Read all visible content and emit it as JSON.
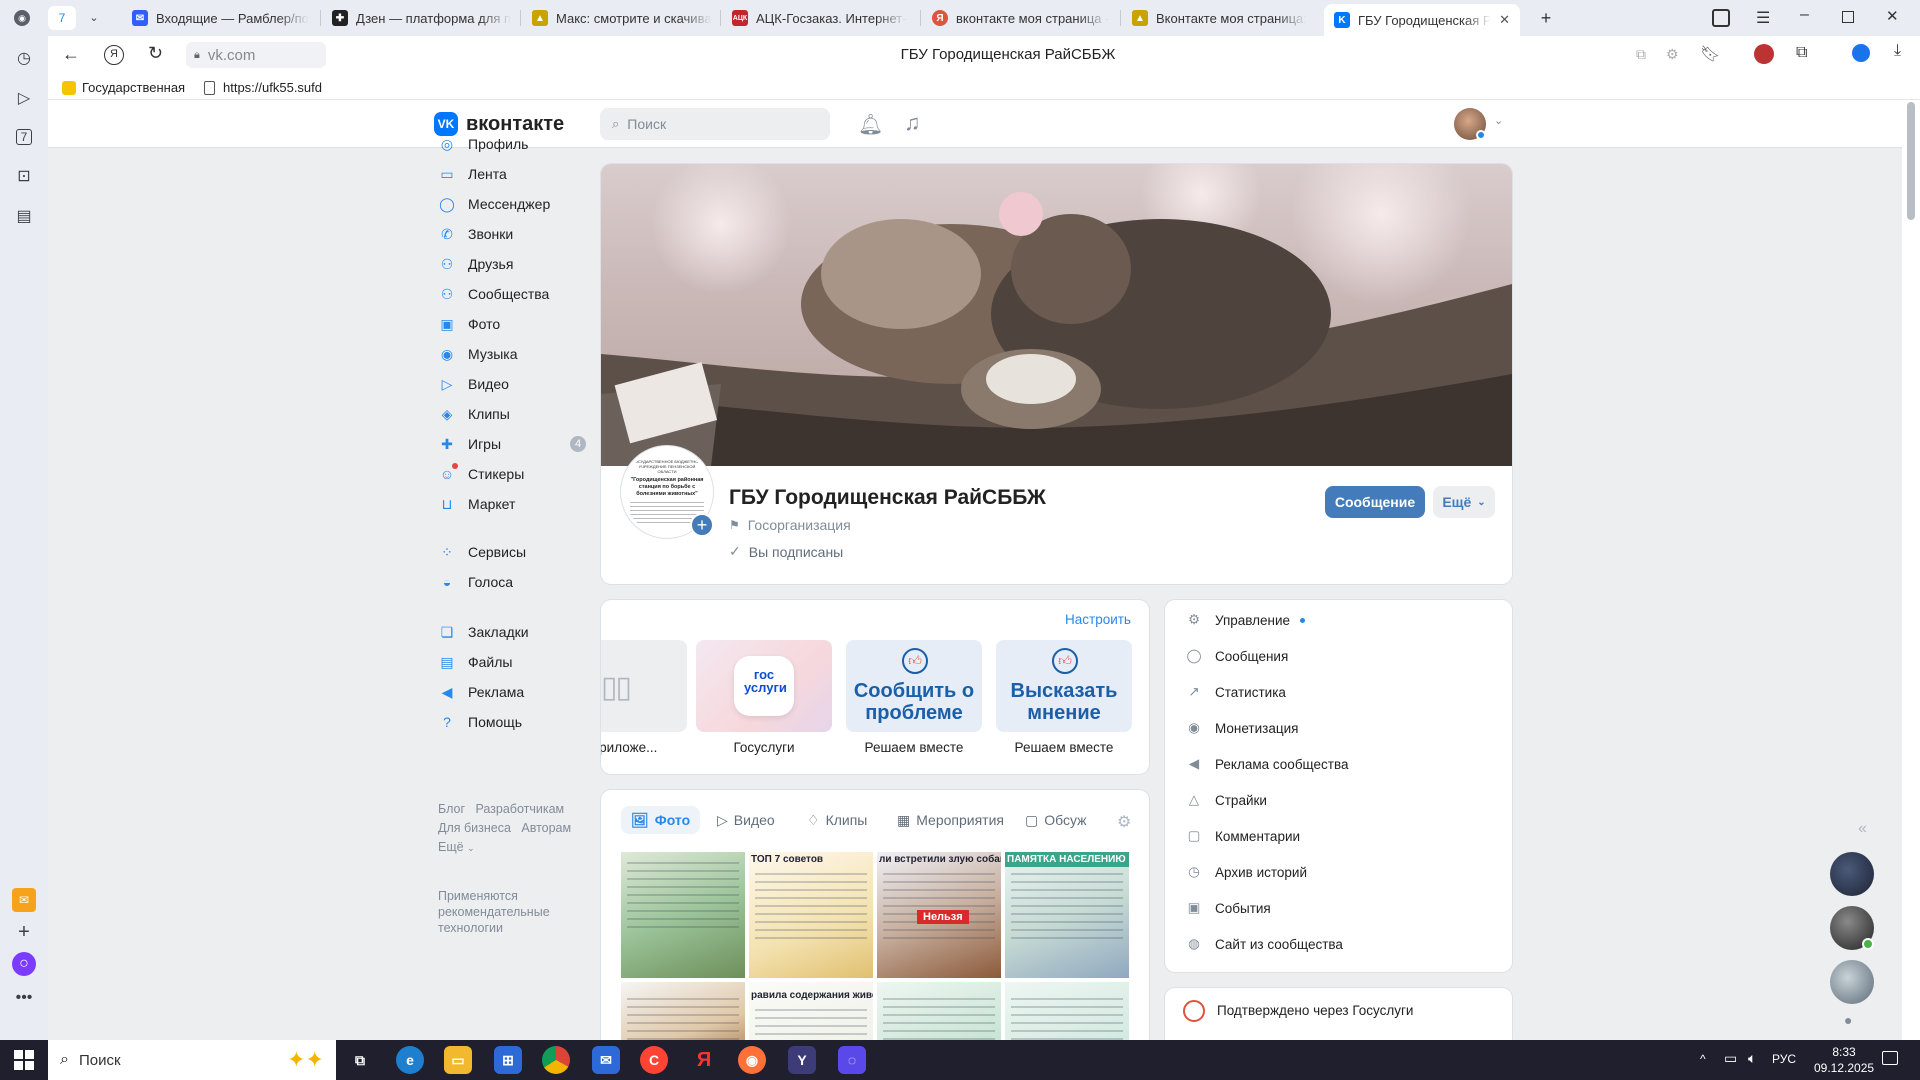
{
  "browser": {
    "tab_count": "7",
    "tabs": [
      {
        "title": "Входящие — Рамблер/по"
      },
      {
        "title": "Дзен — платформа для п"
      },
      {
        "title": "Макс: смотрите и скачива"
      },
      {
        "title": "АЦК-Госзаказ. Интернет-"
      },
      {
        "title": "вконтакте моя страница -"
      },
      {
        "title": "Вконтакте моя страница:"
      },
      {
        "title": "ГБУ Городищенская Ра"
      }
    ],
    "address": "vk.com",
    "page_title": "ГБУ Городищенская РайСББЖ",
    "bookmarks": [
      {
        "label": "Государственная"
      },
      {
        "label": "https://ufk55.sufd"
      }
    ],
    "sidebar_badge": "7"
  },
  "vk": {
    "logo_text": "вконтакте",
    "search_placeholder": "Поиск",
    "nav": [
      {
        "label": "Профиль",
        "icon": "profile-icon"
      },
      {
        "label": "Лента",
        "icon": "feed-icon"
      },
      {
        "label": "Мессенджер",
        "icon": "messenger-icon"
      },
      {
        "label": "Звонки",
        "icon": "phone-icon"
      },
      {
        "label": "Друзья",
        "icon": "friends-icon"
      },
      {
        "label": "Сообщества",
        "icon": "communities-icon"
      },
      {
        "label": "Фото",
        "icon": "photo-icon"
      },
      {
        "label": "Музыка",
        "icon": "music-icon"
      },
      {
        "label": "Видео",
        "icon": "video-icon"
      },
      {
        "label": "Клипы",
        "icon": "clips-icon"
      },
      {
        "label": "Игры",
        "icon": "games-icon",
        "badge": "4"
      },
      {
        "label": "Стикеры",
        "icon": "stickers-icon"
      },
      {
        "label": "Маркет",
        "icon": "market-icon"
      },
      {
        "label": "Сервисы",
        "icon": "services-icon"
      },
      {
        "label": "Голоса",
        "icon": "votes-icon"
      },
      {
        "label": "Закладки",
        "icon": "bookmarks-icon"
      },
      {
        "label": "Файлы",
        "icon": "files-icon"
      },
      {
        "label": "Реклама",
        "icon": "ads-icon"
      },
      {
        "label": "Помощь",
        "icon": "help-icon"
      }
    ],
    "footer_links": {
      "blog": "Блог",
      "devs": "Разработчикам",
      "business": "Для бизнеса",
      "authors": "Авторам",
      "more": "Ещё"
    },
    "footer_note": "Применяются рекомендательные технологии",
    "group": {
      "name": "ГБУ Городищенская РайСББЖ",
      "type": "Госорганизация",
      "subscribed": "Вы подписаны",
      "message_button": "Сообщение",
      "more_button": "Ещё",
      "avatar_lines": [
        "ГОСУДАРСТВЕННОЕ БЮДЖЕТНОЕ УЧРЕЖДЕНИЕ ПЕНЗЕНСКОЙ ОБЛАСТИ",
        "\"Городищенская районная станция по борьбе с болезнями животных\""
      ]
    },
    "apps": {
      "configure": "Настроить",
      "items": [
        {
          "label": "о приложе..."
        },
        {
          "label": "Госуслуги",
          "tile_text": "гос услуги"
        },
        {
          "label": "Решаем вместе",
          "tile_text": "Сообщить о проблеме"
        },
        {
          "label": "Решаем вместе",
          "tile_text": "Высказать мнение"
        }
      ]
    },
    "media_tabs": [
      {
        "label": "Фото",
        "active": true
      },
      {
        "label": "Видео"
      },
      {
        "label": "Клипы"
      },
      {
        "label": "Мероприятия"
      },
      {
        "label": "Обсуж"
      }
    ],
    "thumbs": [
      {
        "caption": ""
      },
      {
        "caption": "ТОП 7 советов"
      },
      {
        "caption": "ли встретили злую собак"
      },
      {
        "caption": "ПАМЯТКА НАСЕЛЕНИЮ"
      },
      {
        "caption": ""
      },
      {
        "caption": "равила содержания животн"
      },
      {
        "caption": ""
      },
      {
        "caption": ""
      }
    ],
    "thumb_badge": "Нельзя",
    "manage_menu": [
      {
        "label": "Управление",
        "icon": "gear-icon",
        "dot": true
      },
      {
        "label": "Сообщения",
        "icon": "chat-icon"
      },
      {
        "label": "Статистика",
        "icon": "stats-icon"
      },
      {
        "label": "Монетизация",
        "icon": "money-icon"
      },
      {
        "label": "Реклама сообщества",
        "icon": "megaphone-icon"
      },
      {
        "label": "Страйки",
        "icon": "warning-icon"
      },
      {
        "label": "Комментарии",
        "icon": "comment-icon"
      },
      {
        "label": "Архив историй",
        "icon": "archive-icon"
      },
      {
        "label": "События",
        "icon": "events-icon"
      },
      {
        "label": "Сайт из сообщества",
        "icon": "globe-icon"
      }
    ],
    "verified": "Подтверждено через Госуслуги"
  },
  "taskbar": {
    "search": "Поиск",
    "lang": "РУС",
    "time": "8:33",
    "date": "09.12.2025"
  },
  "colors": {
    "vk_blue": "#0077ff",
    "button_blue": "#447bba",
    "accent": "#2688eb"
  }
}
